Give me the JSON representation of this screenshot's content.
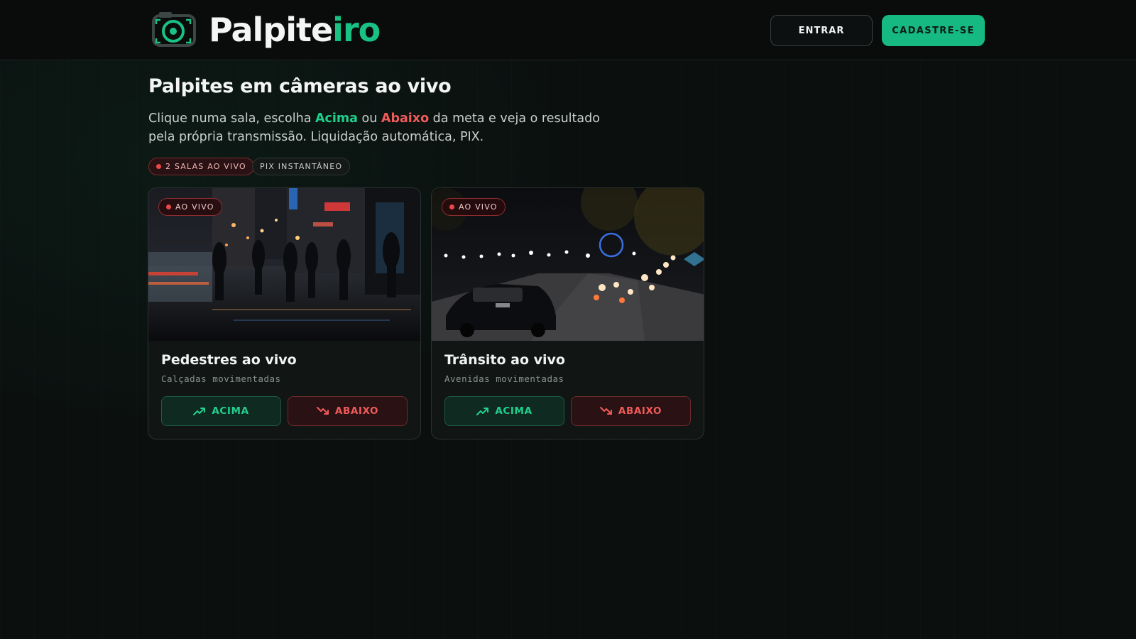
{
  "brand": {
    "name_part1": "Palpite",
    "name_part2": "iro",
    "logo_icon": "camera-icon"
  },
  "header": {
    "login_label": "ENTRAR",
    "signup_label": "CADASTRE-SE"
  },
  "hero": {
    "title": "Palpites em câmeras ao vivo",
    "desc_1": "Clique numa sala, escolha ",
    "desc_up": "Acima",
    "desc_2": " ou ",
    "desc_down": "Abaixo",
    "desc_3": " da meta e veja o resultado pela própria transmissão. Liquidação automática, PIX.",
    "pill_live": "2 SALAS AO VIVO",
    "pill_pix": "PIX INSTANTÂNEO"
  },
  "rooms": [
    {
      "badge": "AO VIVO",
      "title": "Pedestres ao vivo",
      "subtitle": "Calçadas movimentadas",
      "up_label": "ACIMA",
      "down_label": "ABAIXO"
    },
    {
      "badge": "AO VIVO",
      "title": "Trânsito ao vivo",
      "subtitle": "Avenidas movimentadas",
      "up_label": "ACIMA",
      "down_label": "ABAIXO"
    }
  ],
  "colors": {
    "accent": "#16b981",
    "up": "#22d08f",
    "down": "#f05a5a",
    "live": "#e84848",
    "background": "#0b0f0e"
  },
  "icons": {
    "up": "trending-up-icon",
    "down": "trending-down-icon"
  }
}
